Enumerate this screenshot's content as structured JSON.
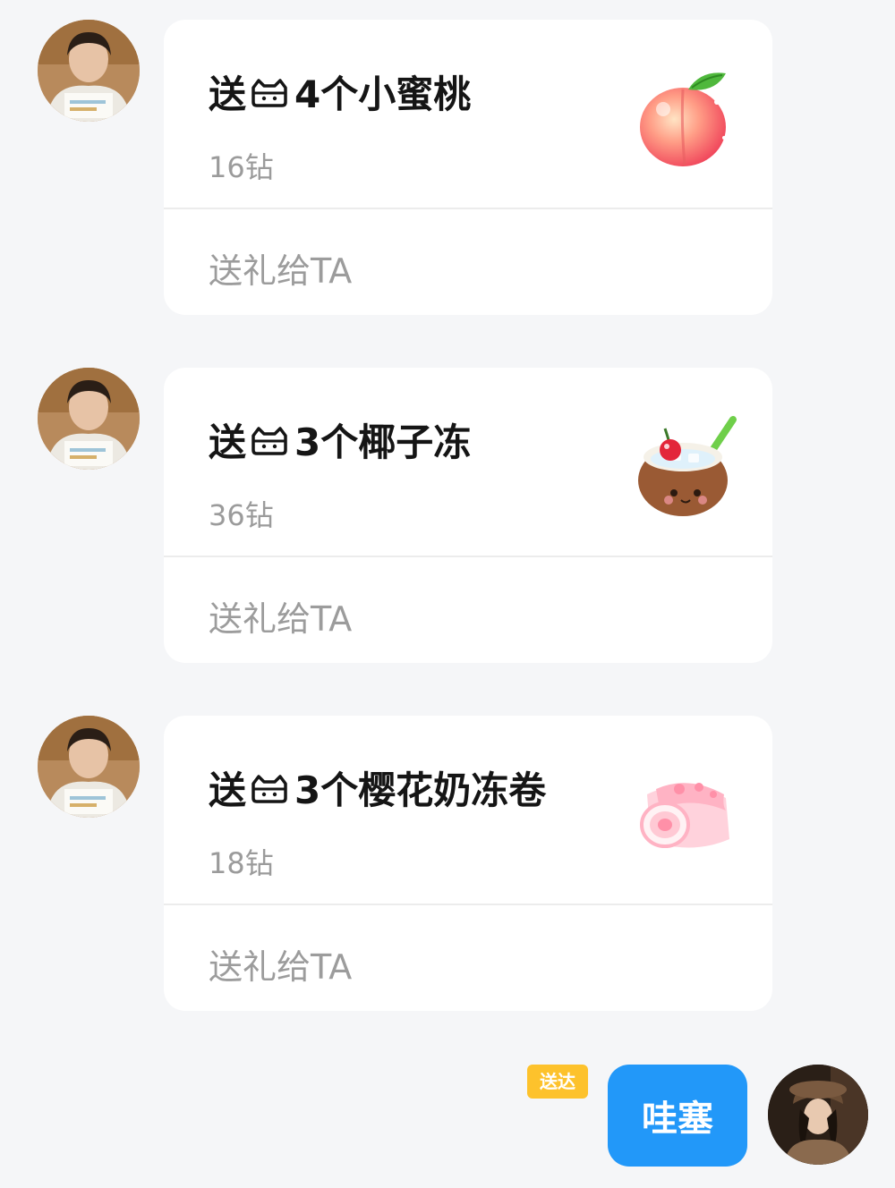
{
  "messages": [
    {
      "gift_prefix": "送",
      "gift_suffix": "4个小蜜桃",
      "price": "16钻",
      "action_label": "送礼给TA",
      "gift_image_icon": "peach-icon"
    },
    {
      "gift_prefix": "送",
      "gift_suffix": "3个椰子冻",
      "price": "36钻",
      "action_label": "送礼给TA",
      "gift_image_icon": "coconut-jelly-icon"
    },
    {
      "gift_prefix": "送",
      "gift_suffix": "3个樱花奶冻卷",
      "price": "18钻",
      "action_label": "送礼给TA",
      "gift_image_icon": "sakura-roll-icon"
    }
  ],
  "self_message": {
    "status": "送达",
    "text": "哇塞"
  },
  "colors": {
    "background": "#f5f6f8",
    "card": "#ffffff",
    "bubble": "#2298f9",
    "badge": "#fdc22c",
    "muted_text": "#9b9b9b"
  }
}
